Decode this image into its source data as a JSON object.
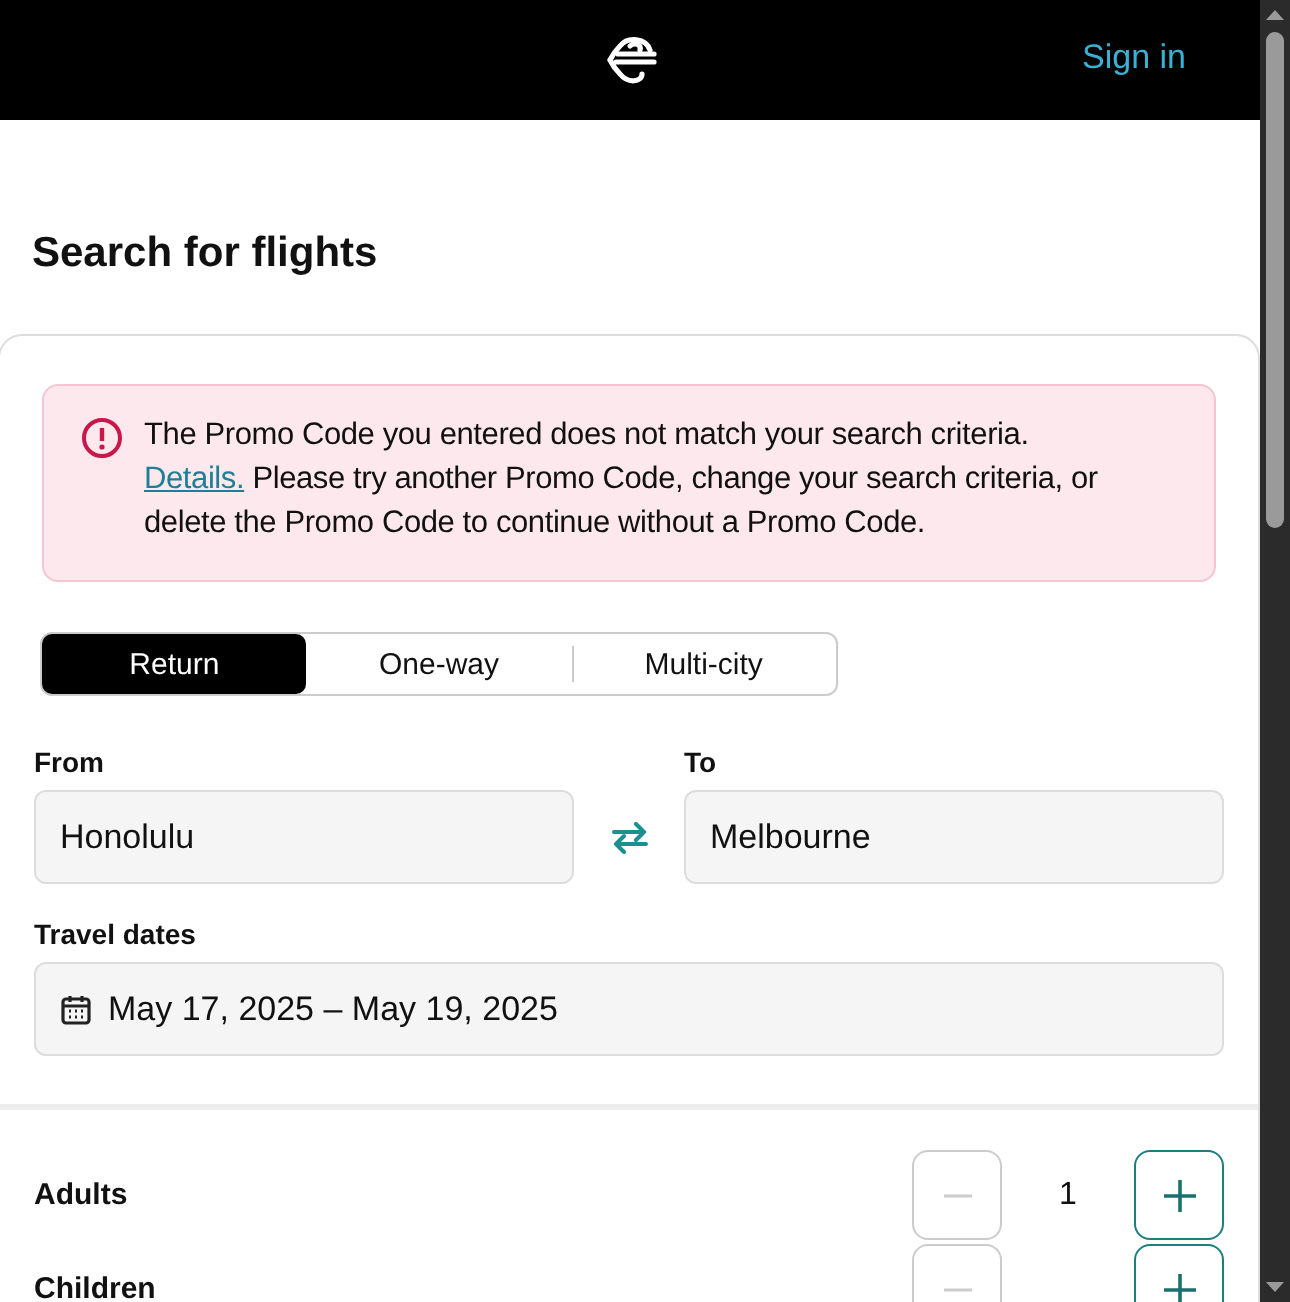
{
  "header": {
    "sign_in": "Sign in"
  },
  "title": "Search for flights",
  "alert": {
    "message_start": "The Promo Code you entered does not match your search criteria.",
    "link": "Details.",
    "message_end": "Please try another Promo Code, change your search criteria, or delete the Promo Code to continue without a Promo Code."
  },
  "trip_types": [
    {
      "label": "Return",
      "selected": true
    },
    {
      "label": "One-way",
      "selected": false
    },
    {
      "label": "Multi-city",
      "selected": false
    }
  ],
  "from": {
    "label": "From",
    "value": "Honolulu"
  },
  "to": {
    "label": "To",
    "value": "Melbourne"
  },
  "travel_dates": {
    "label": "Travel dates",
    "value": "May 17, 2025 – May 19, 2025"
  },
  "passengers": [
    {
      "label": "Adults",
      "count": "1",
      "minus_disabled": true
    },
    {
      "label": "Children",
      "minus_disabled": true
    }
  ]
}
